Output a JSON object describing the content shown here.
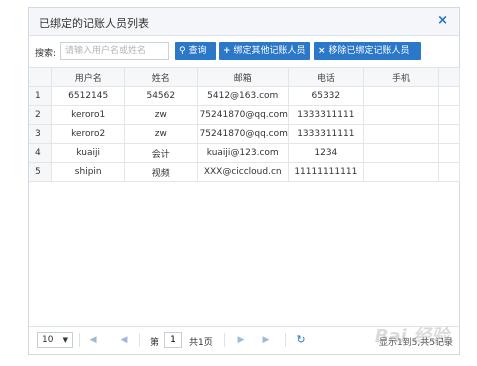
{
  "dialog": {
    "title": "已绑定的记账人员列表",
    "close_label": "×"
  },
  "toolbar": {
    "search_label": "搜索:",
    "search_placeholder": "请输入用户名或姓名",
    "query_icon": "search-icon",
    "query_label": "查询",
    "add_icon": "plus-icon",
    "add_label": "绑定其他记账人员",
    "remove_icon": "x-icon",
    "remove_label": "移除已绑定记账人员"
  },
  "table": {
    "columns": [
      "用户名",
      "姓名",
      "邮箱",
      "电话",
      "手机"
    ],
    "rows": [
      {
        "num": "1",
        "username": "6512145",
        "name": "54562",
        "email": "5412@163.com",
        "phone": "65332",
        "mobile": ""
      },
      {
        "num": "2",
        "username": "keroro1",
        "name": "zw",
        "email": "75241870@qq.com",
        "phone": "1333311111",
        "mobile": ""
      },
      {
        "num": "3",
        "username": "keroro2",
        "name": "zw",
        "email": "75241870@qq.com",
        "phone": "1333311111",
        "mobile": ""
      },
      {
        "num": "4",
        "username": "kuaiji",
        "name": "会计",
        "email": "kuaiji@123.com",
        "phone": "1234",
        "mobile": ""
      },
      {
        "num": "5",
        "username": "shipin",
        "name": "视频",
        "email": "XXX@ciccloud.cn",
        "phone": "11111111111",
        "mobile": ""
      }
    ]
  },
  "pager": {
    "page_size": "10",
    "page_prefix": "第",
    "page_value": "1",
    "page_total": "共1页",
    "info": "显示1到5,共5记录",
    "watermark": "Bai 经验"
  },
  "colors": {
    "accent": "#2b78c9",
    "header_bg": "#f4f6f9"
  }
}
